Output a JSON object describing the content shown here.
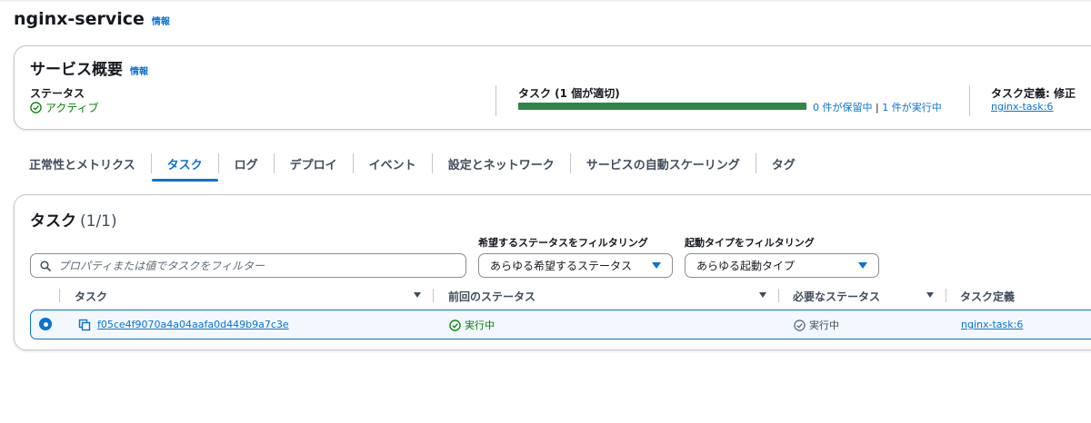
{
  "page": {
    "title": "nginx-service",
    "info": "情報"
  },
  "summary": {
    "title": "サービス概要",
    "info": "情報",
    "status": {
      "label": "ステータス",
      "value": "アクティブ"
    },
    "tasks": {
      "label": "タスク (1 個が適切)",
      "progress": 1.0,
      "pending_text": "0 件が保留中",
      "separator": " | ",
      "running_text": "1 件が実行中"
    },
    "task_definition": {
      "label": "タスク定義: 修正",
      "value": "nginx-task:6"
    }
  },
  "tabs": [
    {
      "label": "正常性とメトリクス"
    },
    {
      "label": "タスク"
    },
    {
      "label": "ログ"
    },
    {
      "label": "デプロイ"
    },
    {
      "label": "イベント"
    },
    {
      "label": "設定とネットワーク"
    },
    {
      "label": "サービスの自動スケーリング"
    },
    {
      "label": "タグ"
    }
  ],
  "active_tab": "タスク",
  "tasks_panel": {
    "title": "タスク",
    "count": "(1/1)",
    "search_placeholder": "プロパティまたは値でタスクをフィルター",
    "desired_filter": {
      "label": "希望するステータスをフィルタリング",
      "value": "あらゆる希望するステータス"
    },
    "launch_filter": {
      "label": "起動タイプをフィルタリング",
      "value": "あらゆる起動タイプ"
    },
    "columns": [
      "タスク",
      "前回のステータス",
      "必要なステータス",
      "タスク定義"
    ],
    "rows": [
      {
        "task": "f05ce4f9070a4a04aafa0d449b9a7c3e",
        "last_status": "実行中",
        "desired_status": "実行中",
        "task_definition": "nginx-task:6",
        "selected": true
      }
    ]
  },
  "colors": {
    "accent": "#0972d3",
    "success": "#037f0c",
    "progress": "#2f8747"
  }
}
